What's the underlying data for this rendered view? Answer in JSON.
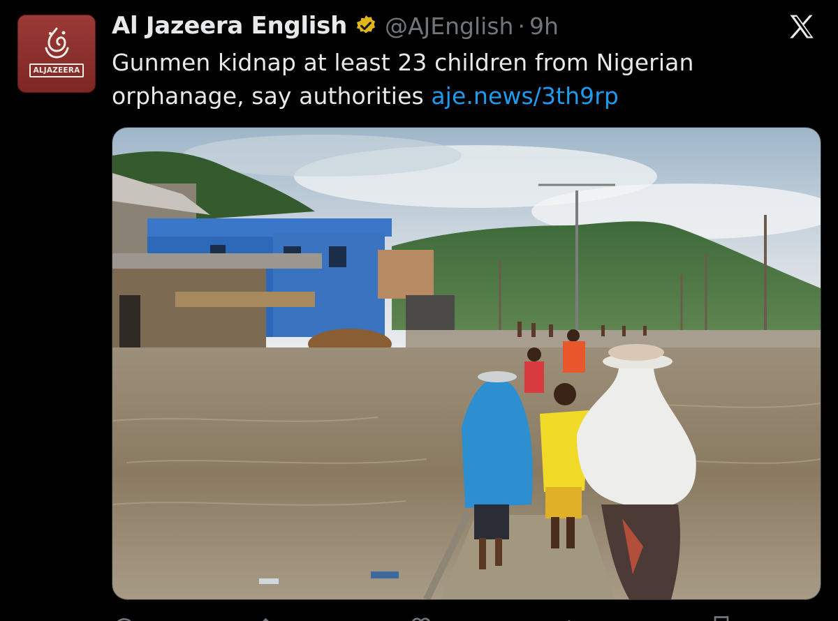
{
  "tweet": {
    "display_name": "Al Jazeera English",
    "handle": "@AJEnglish",
    "separator": "·",
    "time": "9h",
    "text": "Gunmen kidnap at least 23 children from Nigerian orphanage, say authorities",
    "link": "aje.news/3th9rp"
  },
  "avatar": {
    "logo_text": "ALJAZEERA",
    "background_color": "#8c2f2c"
  },
  "colors": {
    "background": "#000000",
    "text_primary": "#e7e9ea",
    "text_secondary": "#71767b",
    "link": "#1d9bf0",
    "verified_badge": "#e2b719"
  },
  "icons": {
    "verified": "gold-verified-badge-icon",
    "platform": "x-logo-icon",
    "actions": [
      "reply-icon",
      "repost-icon",
      "like-icon",
      "views-icon",
      "bookmark-icon"
    ]
  },
  "media": {
    "type": "photo"
  }
}
